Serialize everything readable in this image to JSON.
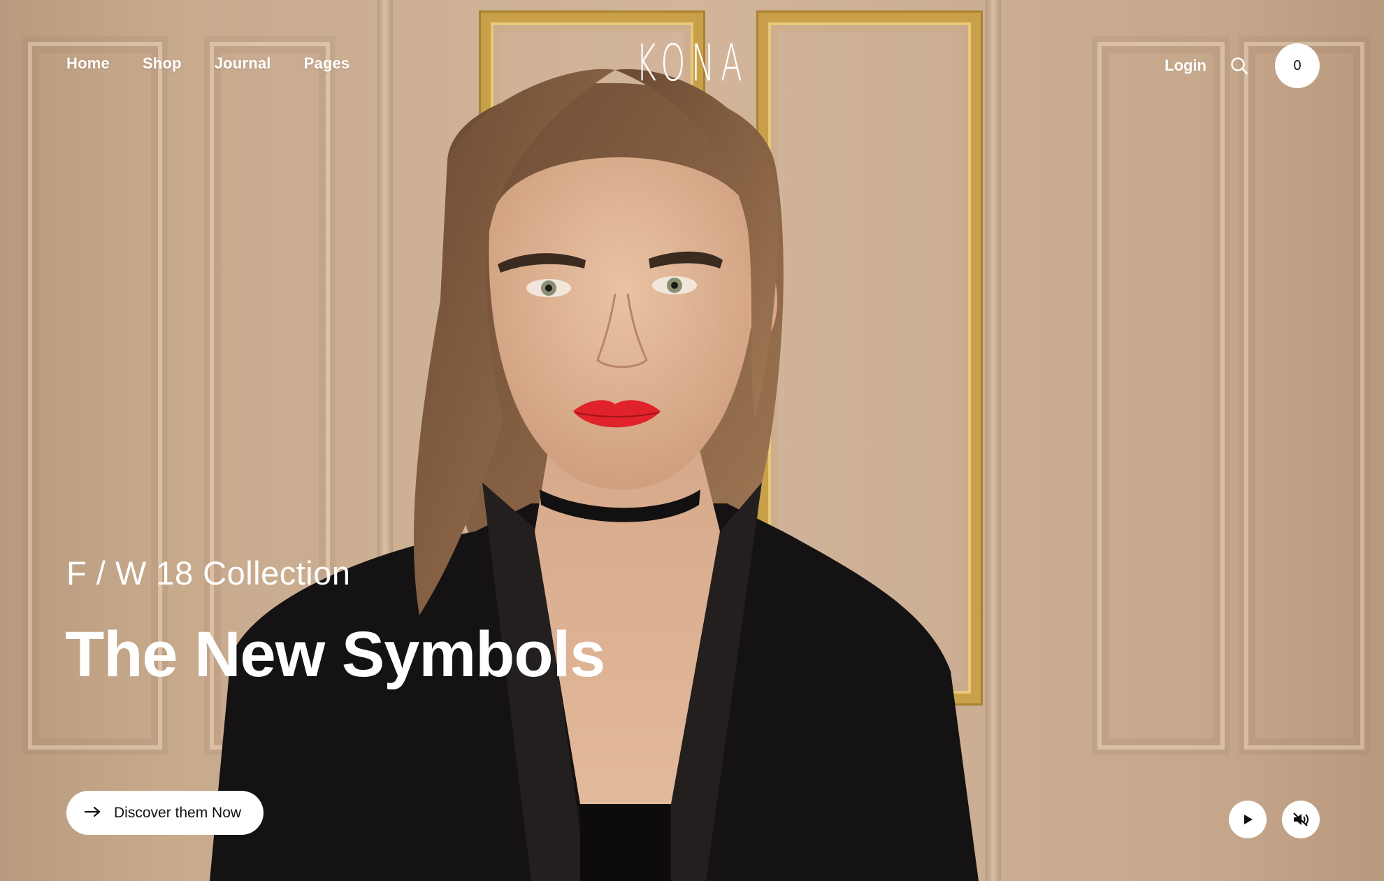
{
  "nav": {
    "items": [
      {
        "label": "Home"
      },
      {
        "label": "Shop"
      },
      {
        "label": "Journal"
      },
      {
        "label": "Pages"
      }
    ]
  },
  "brand": {
    "logo": "KONA"
  },
  "account": {
    "login_label": "Login",
    "search_icon": "search-icon"
  },
  "cart": {
    "count": "0"
  },
  "hero": {
    "eyebrow": "F / W 18 Collection",
    "headline": "The New Symbols",
    "cta_label": "Discover them Now",
    "cta_icon": "arrow-right-icon"
  },
  "media": {
    "play_icon": "play-icon",
    "mute_icon": "mute-icon"
  },
  "colors": {
    "text": "#ffffff",
    "button_bg": "#ffffff",
    "button_text": "#111111",
    "lips": "#e0232b",
    "gold_trim": "#c9a04a"
  }
}
